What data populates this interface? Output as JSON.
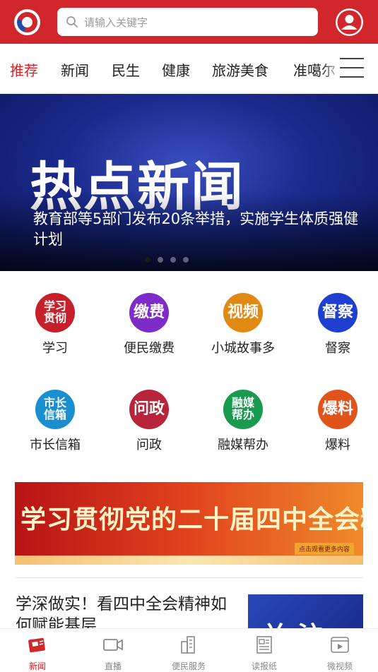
{
  "header": {
    "search_placeholder": "请输入关键字",
    "brand_color": "#d0262c"
  },
  "tabs": [
    {
      "label": "推荐",
      "active": true
    },
    {
      "label": "新闻",
      "active": false
    },
    {
      "label": "民生",
      "active": false
    },
    {
      "label": "健康",
      "active": false
    },
    {
      "label": "旅游美食",
      "active": false
    },
    {
      "label": "准噶尔",
      "active": false
    }
  ],
  "banner": {
    "image_text": "热点新闻",
    "caption": "教育部等5部门发布20条举措，实施学生体质强健计划",
    "slides": 4,
    "current_slide": 1
  },
  "services": [
    {
      "label": "学习",
      "icon_text": "学习贯彻",
      "color": "#c8202a",
      "icon": "study-icon"
    },
    {
      "label": "便民缴费",
      "icon_text": "缴费",
      "color": "#7d2bc9",
      "icon": "payment-icon"
    },
    {
      "label": "小城故事多",
      "icon_text": "视频",
      "color": "#e08a14",
      "icon": "video-icon"
    },
    {
      "label": "督察",
      "icon_text": "督察",
      "color": "#1f3fd0",
      "icon": "inspection-icon"
    },
    {
      "label": "市长信箱",
      "icon_text": "市长信箱",
      "color": "#1a8fd0",
      "icon": "mailbox-icon"
    },
    {
      "label": "问政",
      "icon_text": "问政",
      "color": "#b8243a",
      "icon": "inquiry-icon"
    },
    {
      "label": "融媒帮办",
      "icon_text": "融媒帮办",
      "color": "#1a9a4e",
      "icon": "media-help-icon"
    },
    {
      "label": "爆料",
      "icon_text": "爆料",
      "color": "#e0541c",
      "icon": "tipoff-icon"
    }
  ],
  "promo": {
    "title": "学习贯彻党的二十届四中全会精神",
    "link_text": "点击观看更多内容"
  },
  "article": {
    "title": "学深做实！看四中全会精神如何赋能基层",
    "thumb_text": "关注"
  },
  "bottom_nav": [
    {
      "label": "新闻",
      "active": true,
      "icon": "news-icon"
    },
    {
      "label": "直播",
      "active": false,
      "icon": "live-icon"
    },
    {
      "label": "便民服务",
      "active": false,
      "icon": "city-service-icon"
    },
    {
      "label": "读报纸",
      "active": false,
      "icon": "newspaper-icon"
    },
    {
      "label": "微视频",
      "active": false,
      "icon": "micro-video-icon"
    }
  ]
}
